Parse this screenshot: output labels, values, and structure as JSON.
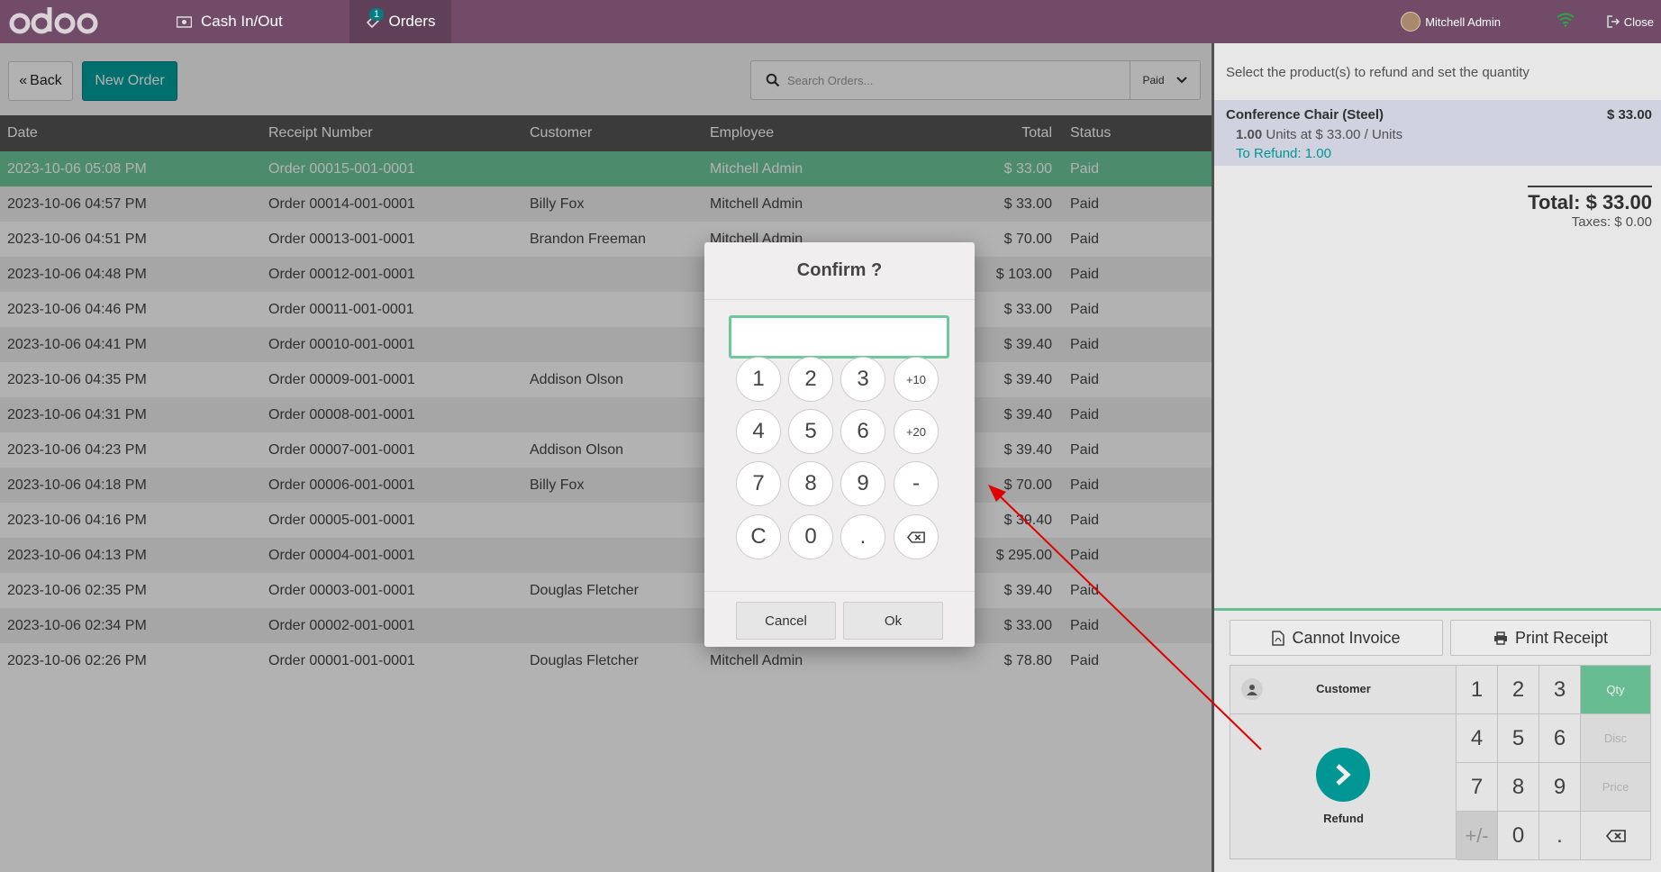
{
  "topbar": {
    "logo_text": "odoo",
    "cash_label": "Cash In/Out",
    "orders_label": "Orders",
    "orders_badge": "1",
    "user_name": "Mitchell Admin",
    "close_label": "Close",
    "colors": {
      "bar": "#714b67",
      "active_tab": "#5f4058",
      "badge": "#017e84"
    }
  },
  "controls": {
    "back_label": "Back",
    "new_order_label": "New Order",
    "search_placeholder": "Search Orders...",
    "filter_value": "Paid"
  },
  "table": {
    "headers": {
      "date": "Date",
      "receipt": "Receipt Number",
      "customer": "Customer",
      "employee": "Employee",
      "total": "Total",
      "status": "Status"
    },
    "rows": [
      {
        "date": "2023-10-06 05:08 PM",
        "receipt": "Order 00015-001-0001",
        "customer": "",
        "employee": "Mitchell Admin",
        "total": "$ 33.00",
        "status": "Paid"
      },
      {
        "date": "2023-10-06 04:57 PM",
        "receipt": "Order 00014-001-0001",
        "customer": "Billy Fox",
        "employee": "Mitchell Admin",
        "total": "$ 33.00",
        "status": "Paid"
      },
      {
        "date": "2023-10-06 04:51 PM",
        "receipt": "Order 00013-001-0001",
        "customer": "Brandon Freeman",
        "employee": "Mitchell Admin",
        "total": "$ 70.00",
        "status": "Paid"
      },
      {
        "date": "2023-10-06 04:48 PM",
        "receipt": "Order 00012-001-0001",
        "customer": "",
        "employee": "",
        "total": "$ 103.00",
        "status": "Paid"
      },
      {
        "date": "2023-10-06 04:46 PM",
        "receipt": "Order 00011-001-0001",
        "customer": "",
        "employee": "",
        "total": "$ 33.00",
        "status": "Paid"
      },
      {
        "date": "2023-10-06 04:41 PM",
        "receipt": "Order 00010-001-0001",
        "customer": "",
        "employee": "",
        "total": "$ 39.40",
        "status": "Paid"
      },
      {
        "date": "2023-10-06 04:35 PM",
        "receipt": "Order 00009-001-0001",
        "customer": "Addison Olson",
        "employee": "",
        "total": "$ 39.40",
        "status": "Paid"
      },
      {
        "date": "2023-10-06 04:31 PM",
        "receipt": "Order 00008-001-0001",
        "customer": "",
        "employee": "",
        "total": "$ 39.40",
        "status": "Paid"
      },
      {
        "date": "2023-10-06 04:23 PM",
        "receipt": "Order 00007-001-0001",
        "customer": "Addison Olson",
        "employee": "",
        "total": "$ 39.40",
        "status": "Paid"
      },
      {
        "date": "2023-10-06 04:18 PM",
        "receipt": "Order 00006-001-0001",
        "customer": "Billy Fox",
        "employee": "",
        "total": "$ 70.00",
        "status": "Paid"
      },
      {
        "date": "2023-10-06 04:16 PM",
        "receipt": "Order 00005-001-0001",
        "customer": "",
        "employee": "",
        "total": "$ 39.40",
        "status": "Paid"
      },
      {
        "date": "2023-10-06 04:13 PM",
        "receipt": "Order 00004-001-0001",
        "customer": "",
        "employee": "",
        "total": "$ 295.00",
        "status": "Paid"
      },
      {
        "date": "2023-10-06 02:35 PM",
        "receipt": "Order 00003-001-0001",
        "customer": "Douglas Fletcher",
        "employee": "",
        "total": "$ 39.40",
        "status": "Paid"
      },
      {
        "date": "2023-10-06 02:34 PM",
        "receipt": "Order 00002-001-0001",
        "customer": "",
        "employee": "",
        "total": "$ 33.00",
        "status": "Paid"
      },
      {
        "date": "2023-10-06 02:26 PM",
        "receipt": "Order 00001-001-0001",
        "customer": "Douglas Fletcher",
        "employee": "Mitchell Admin",
        "total": "$ 78.80",
        "status": "Paid"
      }
    ]
  },
  "refund": {
    "hint": "Select the product(s) to refund and set the quantity",
    "line": {
      "product": "Conference Chair (Steel)",
      "price": "$ 33.00",
      "qty": "1.00",
      "unit_info": "Units at $ 33.00 / Units",
      "to_refund": "To Refund: 1.00"
    },
    "total": "Total: $ 33.00",
    "taxes": "Taxes: $ 0.00"
  },
  "actionpad": {
    "invoice_label": "Cannot Invoice",
    "receipt_label": "Print Receipt",
    "customer_label": "Customer",
    "refund_label": "Refund",
    "keys": [
      "1",
      "2",
      "3",
      "4",
      "5",
      "6",
      "7",
      "8",
      "9",
      "+/-",
      "0",
      "."
    ],
    "modes": {
      "qty": "Qty",
      "disc": "Disc",
      "price": "Price"
    }
  },
  "popup": {
    "title": "Confirm ?",
    "input_value": "",
    "keys": [
      "1",
      "2",
      "3",
      "+10",
      "4",
      "5",
      "6",
      "+20",
      "7",
      "8",
      "9",
      "-",
      "C",
      "0",
      "."
    ],
    "cancel_label": "Cancel",
    "ok_label": "Ok"
  }
}
